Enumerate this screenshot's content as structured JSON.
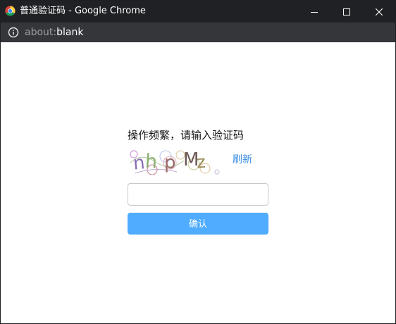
{
  "window": {
    "title": "普通验证码 - Google Chrome",
    "chrome_icon": "chrome-logo-icon",
    "buttons": [
      "minimize-icon",
      "maximize-icon",
      "close-icon"
    ]
  },
  "address_bar": {
    "scheme": "about:",
    "host": "blank",
    "icon": "info-icon"
  },
  "page": {
    "prompt": "操作频繁，请输入验证码",
    "captcha_text": "nhpMz",
    "captcha_chars": [
      "n",
      "h",
      "p",
      "M",
      "z"
    ],
    "refresh_label": "刷新",
    "input_value": "",
    "confirm_label": "确认"
  },
  "colors": {
    "titlebar": "#202124",
    "addressbar": "#35363a",
    "refresh_link": "#3a8ee6",
    "confirm_button": "#4facfe"
  }
}
